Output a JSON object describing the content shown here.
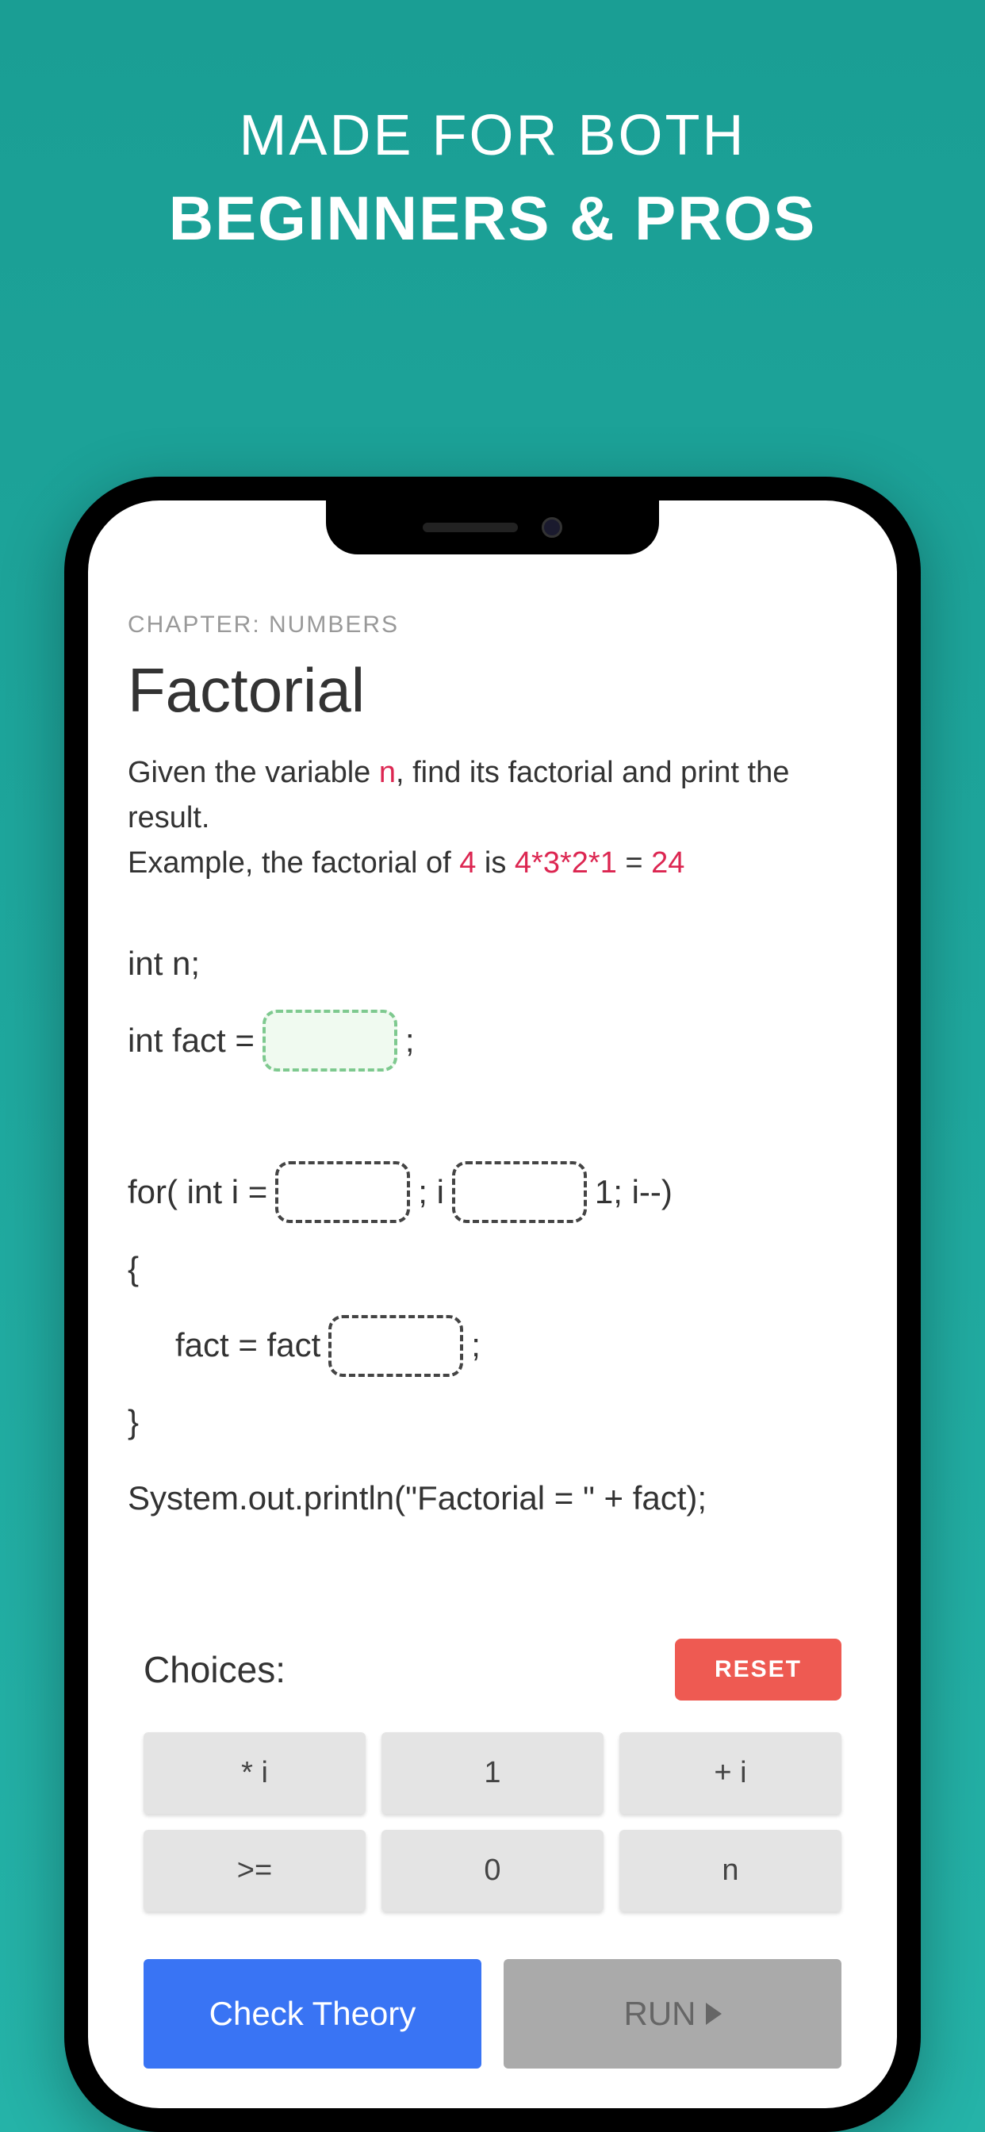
{
  "promo": {
    "line1": "MADE FOR BOTH",
    "line2": "BEGINNERS & PROS"
  },
  "app": {
    "chapter": "CHAPTER: NUMBERS",
    "title": "Factorial",
    "description": {
      "part1": "Given the variable ",
      "var_n": "n",
      "part2": ", find its factorial and print the result.",
      "part3": "Example, the factorial of ",
      "num_4": "4",
      "part4": " is ",
      "expr": "4*3*2*1",
      "part5": " = ",
      "result": "24"
    },
    "code": {
      "line1": "int n;",
      "line2_a": "int fact = ",
      "line2_b": " ;",
      "line3_a": "for( int i = ",
      "line3_b": " ; i ",
      "line3_c": " 1; i--)",
      "line4": "{",
      "line5_a": "fact = fact ",
      "line5_b": " ;",
      "line6": "}",
      "line7": "System.out.println(\"Factorial = \" + fact);"
    },
    "choices": {
      "label": "Choices:",
      "reset": "RESET",
      "items": [
        "* i",
        "1",
        "+ i",
        ">=",
        "0",
        "n"
      ]
    },
    "actions": {
      "theory": "Check Theory",
      "run": "RUN"
    }
  }
}
